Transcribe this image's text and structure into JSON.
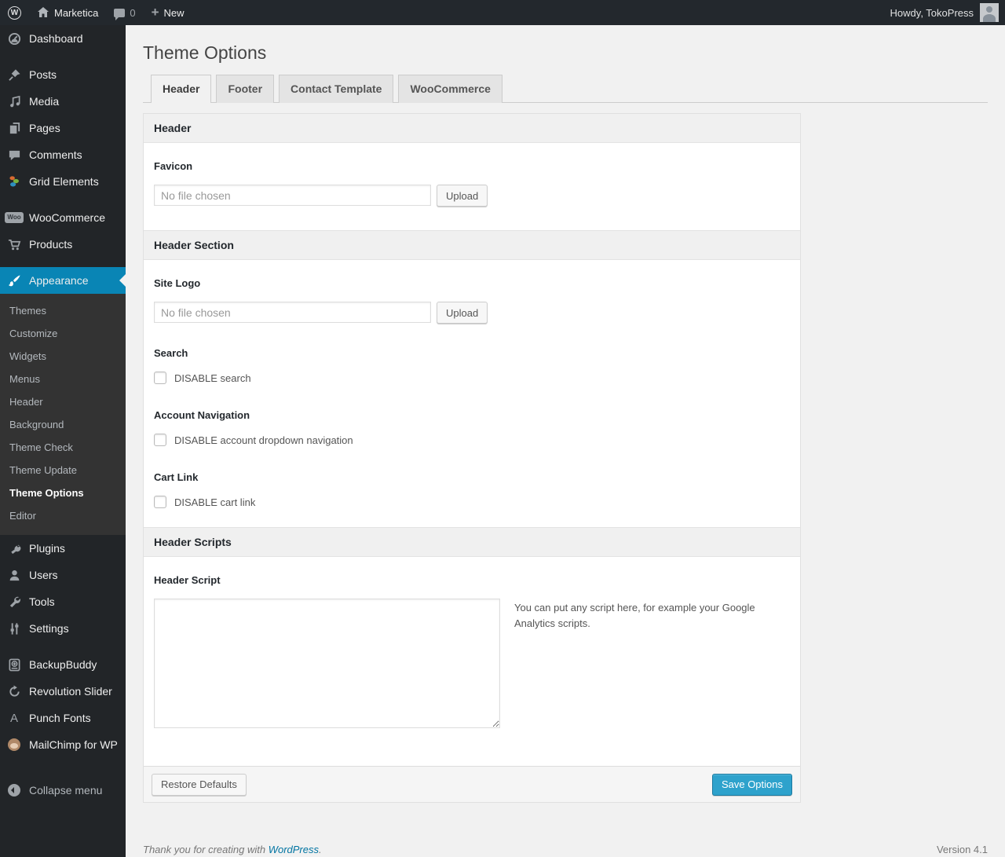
{
  "admin_bar": {
    "site_name": "Marketica",
    "comments_count": "0",
    "new_label": "New",
    "howdy": "Howdy, TokoPress"
  },
  "sidebar": {
    "items": [
      {
        "label": "Dashboard"
      },
      {
        "label": "Posts"
      },
      {
        "label": "Media"
      },
      {
        "label": "Pages"
      },
      {
        "label": "Comments"
      },
      {
        "label": "Grid Elements"
      },
      {
        "label": "WooCommerce"
      },
      {
        "label": "Products"
      },
      {
        "label": "Appearance"
      },
      {
        "label": "Plugins"
      },
      {
        "label": "Users"
      },
      {
        "label": "Tools"
      },
      {
        "label": "Settings"
      },
      {
        "label": "BackupBuddy"
      },
      {
        "label": "Revolution Slider"
      },
      {
        "label": "Punch Fonts"
      },
      {
        "label": "MailChimp for WP"
      },
      {
        "label": "Collapse menu"
      }
    ],
    "appearance_submenu": [
      "Themes",
      "Customize",
      "Widgets",
      "Menus",
      "Header",
      "Background",
      "Theme Check",
      "Theme Update",
      "Theme Options",
      "Editor"
    ],
    "current_submenu_item": "Theme Options"
  },
  "main": {
    "title": "Theme Options",
    "tabs": [
      {
        "label": "Header",
        "active": true
      },
      {
        "label": "Footer",
        "active": false
      },
      {
        "label": "Contact Template",
        "active": false
      },
      {
        "label": "WooCommerce",
        "active": false
      }
    ],
    "sections": {
      "header": "Header",
      "header_section": "Header Section",
      "header_scripts": "Header Scripts"
    },
    "fields": {
      "favicon": {
        "label": "Favicon",
        "value": "No file chosen",
        "button": "Upload"
      },
      "site_logo": {
        "label": "Site Logo",
        "value": "No file chosen",
        "button": "Upload"
      },
      "search": {
        "label": "Search",
        "checkbox": "DISABLE search"
      },
      "account_nav": {
        "label": "Account Navigation",
        "checkbox": "DISABLE account dropdown navigation"
      },
      "cart_link": {
        "label": "Cart Link",
        "checkbox": "DISABLE cart link"
      },
      "header_script": {
        "label": "Header Script",
        "description": "You can put any script here, for example your Google Analytics scripts."
      }
    },
    "buttons": {
      "restore": "Restore Defaults",
      "save": "Save Options"
    }
  },
  "footer": {
    "thanks_prefix": "Thank you for creating with ",
    "link": "WordPress",
    "suffix": ".",
    "version": "Version 4.1"
  },
  "colors": {
    "menu_highlight": "#0985b5",
    "primary_button": "#2ea2cc",
    "link": "#0074a2",
    "sidebar_bg": "#222528",
    "content_bg": "#f1f1f1"
  }
}
